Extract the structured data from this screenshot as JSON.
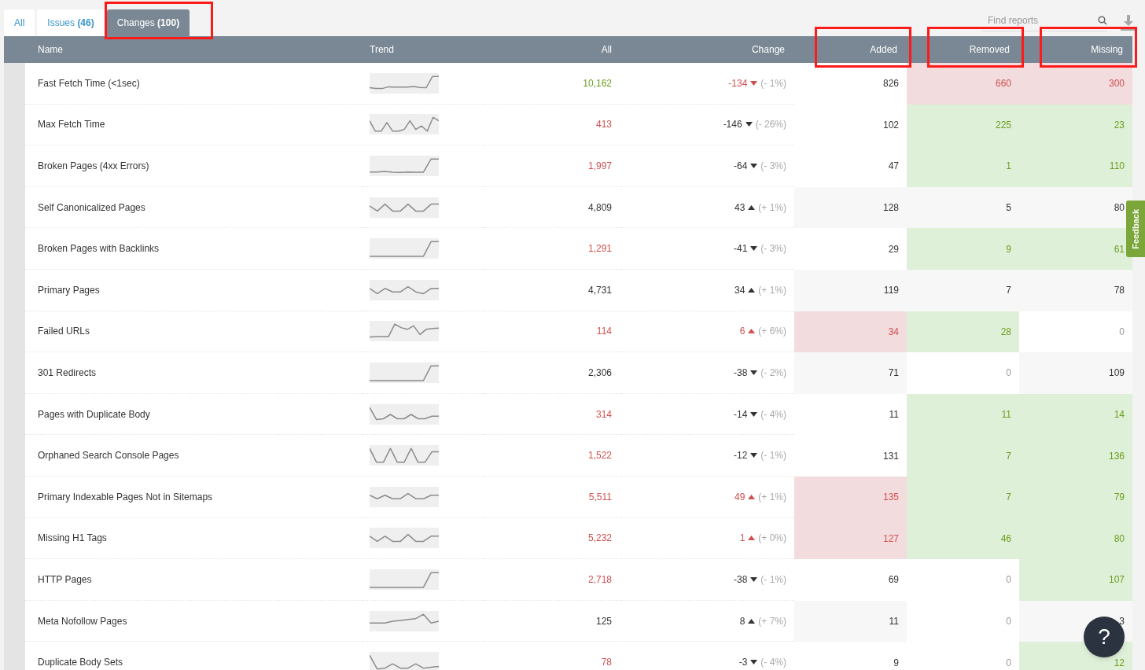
{
  "tabs": [
    {
      "label": "All",
      "selected": false,
      "highlighted": false
    },
    {
      "label": "Issues",
      "count": "(46)",
      "selected": false,
      "highlighted": false
    },
    {
      "label": "Changes",
      "count": "(100)",
      "selected": true,
      "highlighted": true
    }
  ],
  "search": {
    "placeholder": "Find reports"
  },
  "columns": [
    {
      "label": "Name",
      "highlighted": false
    },
    {
      "label": "Trend",
      "highlighted": false
    },
    {
      "label": "All",
      "highlighted": false
    },
    {
      "label": "Change",
      "highlighted": false
    },
    {
      "label": "Added",
      "highlighted": true
    },
    {
      "label": "Removed",
      "highlighted": true
    },
    {
      "label": "Missing",
      "highlighted": true
    }
  ],
  "rows": [
    {
      "name": "Fast Fetch Time (<1sec)",
      "all": {
        "value": "10,162",
        "color": "#6a9e1f"
      },
      "change": "-134",
      "rising": false,
      "change_bad": true,
      "pct": "(- 1%)",
      "cells": [
        {
          "value": "826",
          "kind": "plain"
        },
        {
          "value": "660",
          "kind": "increase"
        },
        {
          "value": "300",
          "kind": "increase"
        }
      ]
    },
    {
      "name": "Max Fetch Time",
      "all": {
        "value": "413",
        "color": "#d05050"
      },
      "change": "-146",
      "rising": false,
      "change_bad": false,
      "pct": "(- 26%)",
      "cells": [
        {
          "value": "102",
          "kind": "plain"
        },
        {
          "value": "225",
          "kind": "decrease"
        },
        {
          "value": "23",
          "kind": "decrease"
        }
      ]
    },
    {
      "name": "Broken Pages (4xx Errors)",
      "all": {
        "value": "1,997",
        "color": "#d05050"
      },
      "change": "-64",
      "rising": false,
      "change_bad": false,
      "pct": "(- 3%)",
      "cells": [
        {
          "value": "47",
          "kind": "plain"
        },
        {
          "value": "1",
          "kind": "decrease"
        },
        {
          "value": "110",
          "kind": "decrease"
        }
      ]
    },
    {
      "name": "Self Canonicalized Pages",
      "all": {
        "value": "4,809",
        "color": "#333333"
      },
      "change": "43",
      "rising": true,
      "change_bad": false,
      "pct": "(+ 1%)",
      "cells": [
        {
          "value": "128",
          "kind": "flat"
        },
        {
          "value": "5",
          "kind": "flat"
        },
        {
          "value": "80",
          "kind": "flat"
        }
      ]
    },
    {
      "name": "Broken Pages with Backlinks",
      "all": {
        "value": "1,291",
        "color": "#d05050"
      },
      "change": "-41",
      "rising": false,
      "change_bad": false,
      "pct": "(- 3%)",
      "cells": [
        {
          "value": "29",
          "kind": "plain"
        },
        {
          "value": "9",
          "kind": "decrease"
        },
        {
          "value": "61",
          "kind": "decrease"
        }
      ]
    },
    {
      "name": "Primary Pages",
      "all": {
        "value": "4,731",
        "color": "#333333"
      },
      "change": "34",
      "rising": true,
      "change_bad": false,
      "pct": "(+ 1%)",
      "cells": [
        {
          "value": "119",
          "kind": "flat"
        },
        {
          "value": "7",
          "kind": "flat"
        },
        {
          "value": "78",
          "kind": "flat"
        }
      ]
    },
    {
      "name": "Failed URLs",
      "all": {
        "value": "114",
        "color": "#d05050"
      },
      "change": "6",
      "rising": true,
      "change_bad": true,
      "pct": "(+ 6%)",
      "cells": [
        {
          "value": "34",
          "kind": "increase"
        },
        {
          "value": "28",
          "kind": "decrease"
        },
        {
          "value": "0",
          "kind": "zero"
        }
      ]
    },
    {
      "name": "301 Redirects",
      "all": {
        "value": "2,306",
        "color": "#333333"
      },
      "change": "-38",
      "rising": false,
      "change_bad": false,
      "pct": "(- 2%)",
      "cells": [
        {
          "value": "71",
          "kind": "flat"
        },
        {
          "value": "0",
          "kind": "zero"
        },
        {
          "value": "109",
          "kind": "flat"
        }
      ]
    },
    {
      "name": "Pages with Duplicate Body",
      "all": {
        "value": "314",
        "color": "#d05050"
      },
      "change": "-14",
      "rising": false,
      "change_bad": false,
      "pct": "(- 4%)",
      "cells": [
        {
          "value": "11",
          "kind": "plain"
        },
        {
          "value": "11",
          "kind": "decrease"
        },
        {
          "value": "14",
          "kind": "decrease"
        }
      ]
    },
    {
      "name": "Orphaned Search Console Pages",
      "all": {
        "value": "1,522",
        "color": "#d05050"
      },
      "change": "-12",
      "rising": false,
      "change_bad": false,
      "pct": "(- 1%)",
      "cells": [
        {
          "value": "131",
          "kind": "plain"
        },
        {
          "value": "7",
          "kind": "decrease"
        },
        {
          "value": "136",
          "kind": "decrease"
        }
      ]
    },
    {
      "name": "Primary Indexable Pages Not in Sitemaps",
      "all": {
        "value": "5,511",
        "color": "#d05050"
      },
      "change": "49",
      "rising": true,
      "change_bad": true,
      "pct": "(+ 1%)",
      "cells": [
        {
          "value": "135",
          "kind": "increase"
        },
        {
          "value": "7",
          "kind": "decrease"
        },
        {
          "value": "79",
          "kind": "decrease"
        }
      ]
    },
    {
      "name": "Missing H1 Tags",
      "all": {
        "value": "5,232",
        "color": "#d05050"
      },
      "change": "1",
      "rising": true,
      "change_bad": true,
      "pct": "(+ 0%)",
      "cells": [
        {
          "value": "127",
          "kind": "increase"
        },
        {
          "value": "46",
          "kind": "decrease"
        },
        {
          "value": "80",
          "kind": "decrease"
        }
      ]
    },
    {
      "name": "HTTP Pages",
      "all": {
        "value": "2,718",
        "color": "#d05050"
      },
      "change": "-38",
      "rising": false,
      "change_bad": false,
      "pct": "(- 1%)",
      "cells": [
        {
          "value": "69",
          "kind": "plain"
        },
        {
          "value": "0",
          "kind": "zero"
        },
        {
          "value": "107",
          "kind": "decrease"
        }
      ]
    },
    {
      "name": "Meta Nofollow Pages",
      "all": {
        "value": "125",
        "color": "#333333"
      },
      "change": "8",
      "rising": true,
      "change_bad": false,
      "pct": "(+ 7%)",
      "cells": [
        {
          "value": "11",
          "kind": "flat"
        },
        {
          "value": "0",
          "kind": "zero"
        },
        {
          "value": "3",
          "kind": "flat"
        }
      ]
    },
    {
      "name": "Duplicate Body Sets",
      "all": {
        "value": "78",
        "color": "#d05050"
      },
      "change": "-3",
      "rising": false,
      "change_bad": false,
      "pct": "(- 4%)",
      "cells": [
        {
          "value": "9",
          "kind": "plain"
        },
        {
          "value": "0",
          "kind": "zero"
        },
        {
          "value": "12",
          "kind": "decrease"
        }
      ]
    }
  ],
  "feedback": "Feedback",
  "help_button": "?"
}
